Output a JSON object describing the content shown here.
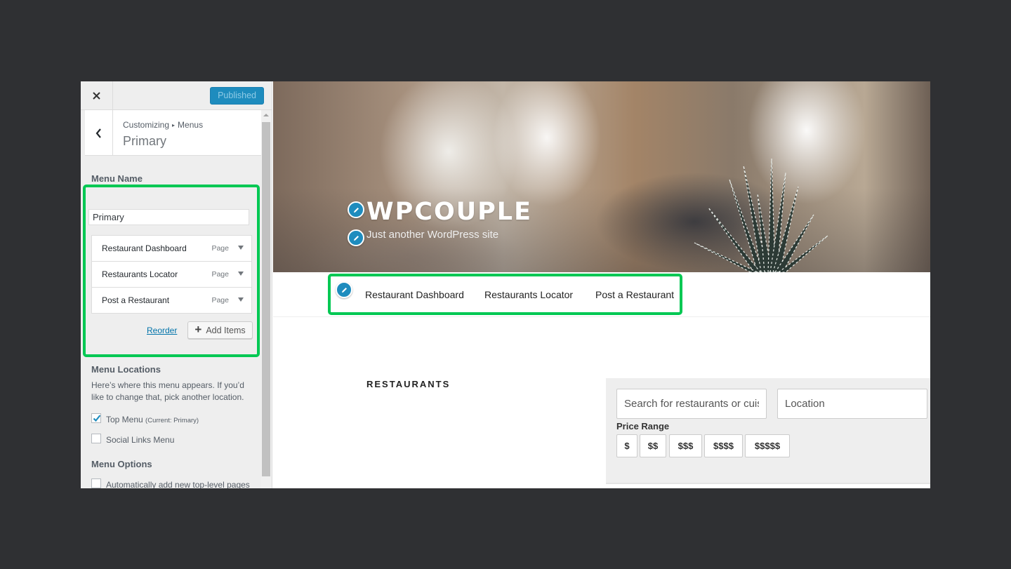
{
  "sidebar": {
    "publish_label": "Published",
    "breadcrumb": {
      "root": "Customizing",
      "separator": "▸",
      "current": "Menus"
    },
    "section_title": "Primary",
    "menu_name_label": "Menu Name",
    "menu_name_value": "Primary",
    "menu_items": [
      {
        "title": "Restaurant Dashboard",
        "type": "Page"
      },
      {
        "title": "Restaurants Locator",
        "type": "Page"
      },
      {
        "title": "Post a Restaurant",
        "type": "Page"
      }
    ],
    "reorder_label": "Reorder",
    "add_items_label": "Add Items",
    "locations_title": "Menu Locations",
    "locations_desc": "Here’s where this menu appears. If you’d like to change that, pick another location.",
    "locations": [
      {
        "label": "Top Menu",
        "note": "(Current: Primary)",
        "checked": true
      },
      {
        "label": "Social Links Menu",
        "note": "",
        "checked": false
      }
    ],
    "options_title": "Menu Options",
    "options": [
      {
        "label": "Automatically add new top-level pages to this menu",
        "checked": false
      }
    ]
  },
  "preview": {
    "site_title": "WPCOUPLE",
    "tagline": "Just another WordPress site",
    "nav_links": [
      "Restaurant Dashboard",
      "Restaurants Locator",
      "Post a Restaurant"
    ],
    "section_heading": "RESTAURANTS",
    "search_placeholder": "Search for restaurants or cuisines",
    "location_placeholder": "Location",
    "price_range_label": "Price Range",
    "price_options": [
      "$",
      "$$",
      "$$$",
      "$$$$",
      "$$$$$"
    ]
  },
  "colors": {
    "accent_blue": "#1e8cbe",
    "highlight_green": "#00c853",
    "link_blue": "#0073aa"
  }
}
